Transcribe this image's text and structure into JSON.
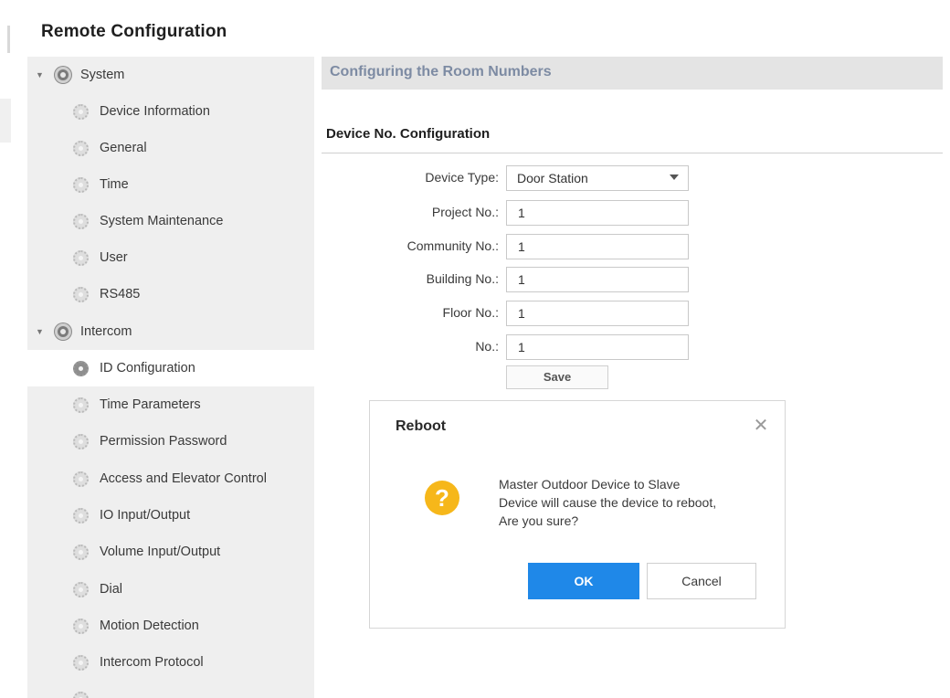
{
  "window": {
    "title": "Remote Configuration"
  },
  "sidebar": {
    "groups": [
      {
        "label": "System",
        "items": [
          "Device Information",
          "General",
          "Time",
          "System Maintenance",
          "User",
          "RS485"
        ]
      },
      {
        "label": "Intercom",
        "items": [
          "ID Configuration",
          "Time Parameters",
          "Permission Password",
          "Access and Elevator Control",
          "IO Input/Output",
          "Volume Input/Output",
          "Dial",
          "Motion Detection",
          "Intercom Protocol"
        ]
      }
    ],
    "selected": "ID Configuration"
  },
  "content": {
    "header": "Configuring the Room Numbers",
    "section_title": "Device No. Configuration",
    "fields": [
      {
        "label": "Device Type:",
        "value": "Door Station"
      },
      {
        "label": "Project No.:",
        "value": "1"
      },
      {
        "label": "Community No.:",
        "value": "1"
      },
      {
        "label": "Building No.:",
        "value": "1"
      },
      {
        "label": "Floor No.:",
        "value": "1"
      },
      {
        "label": "No.:",
        "value": "1"
      }
    ],
    "save_label": "Save"
  },
  "dialog": {
    "title": "Reboot",
    "close_glyph": "✕",
    "icon_glyph": "?",
    "message_lines": [
      "Master Outdoor Device to Slave",
      "Device will cause the device to reboot,",
      "Are you sure?"
    ],
    "ok_label": "OK",
    "cancel_label": "Cancel"
  },
  "colors": {
    "accent": "#1f88e8",
    "warning": "#f6b71a",
    "header_text": "#7d8ba3"
  }
}
